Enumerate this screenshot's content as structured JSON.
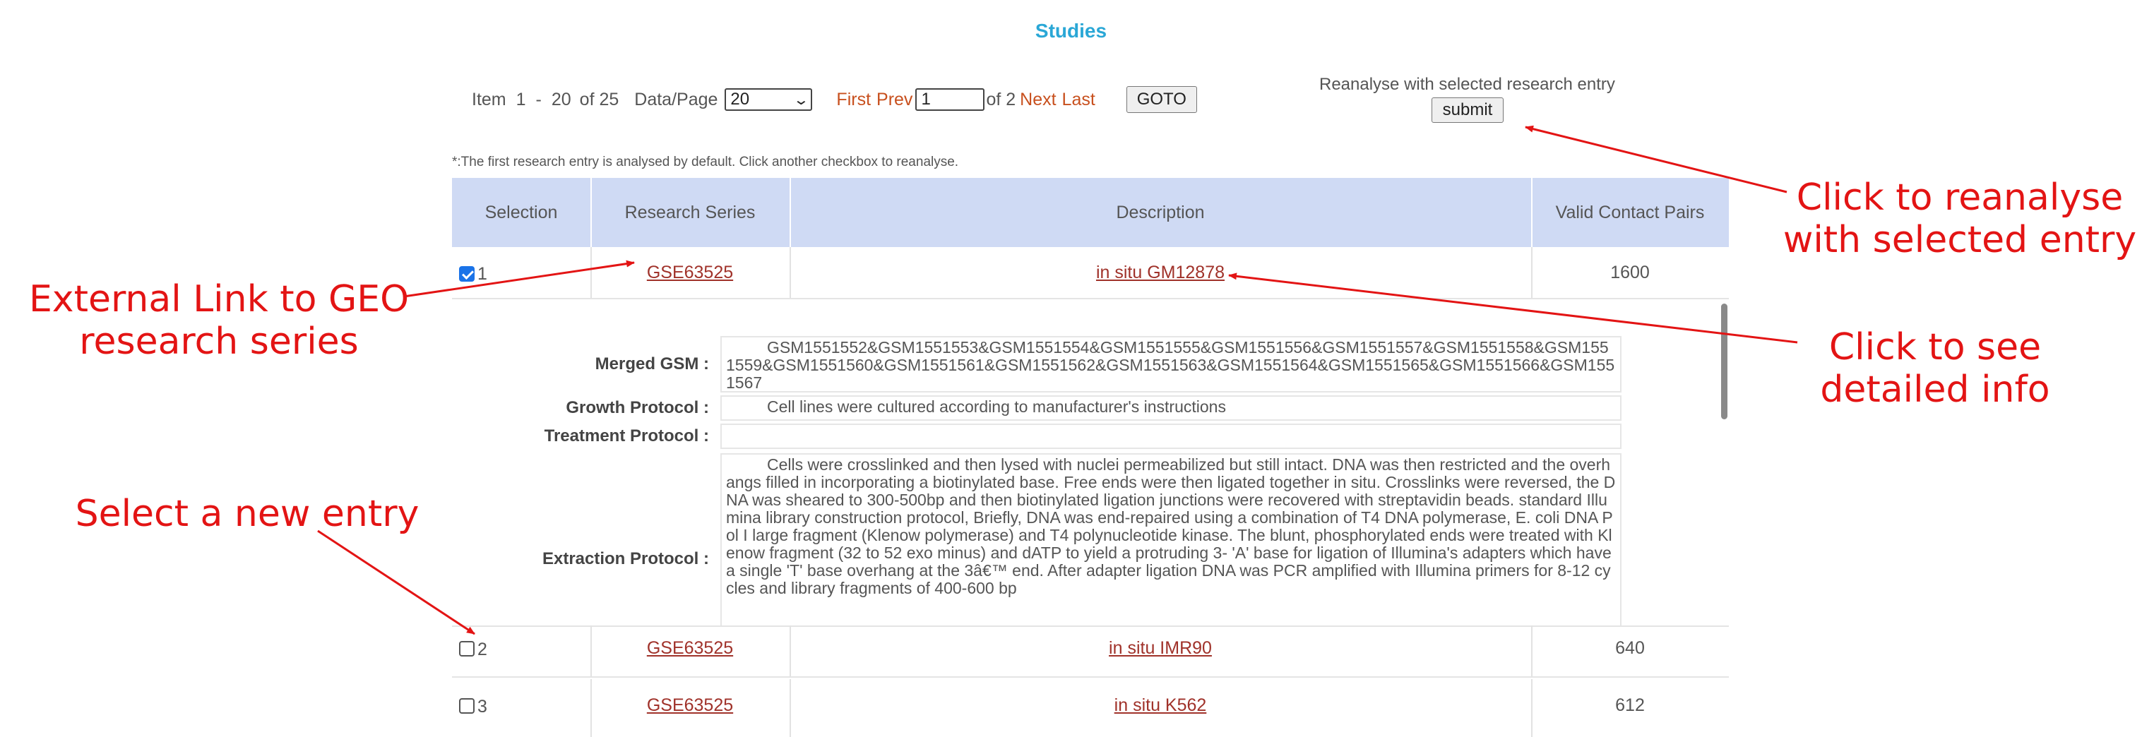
{
  "page": {
    "title": "Studies"
  },
  "pager": {
    "item_label": "Item",
    "item_start": "1",
    "item_dash": "-",
    "item_end": "20",
    "of_total": "of 25",
    "data_page_label": "Data/Page",
    "page_size": "20",
    "first": "First",
    "prev": "Prev",
    "current_page": "1",
    "of_pages": "of 2",
    "next": "Next",
    "last": "Last",
    "goto": "GOTO"
  },
  "reanalyse": {
    "label": "Reanalyse with selected research entry",
    "submit": "submit"
  },
  "note": "*:The first research entry is analysed by default. Click another checkbox to reanalyse.",
  "table": {
    "headers": [
      "Selection",
      "Research Series",
      "Description",
      "Valid Contact Pairs"
    ],
    "rows": [
      {
        "index": "1",
        "checked": true,
        "series": "GSE63525",
        "description": "in situ GM12878",
        "pairs": "1600"
      },
      {
        "index": "2",
        "checked": false,
        "series": "GSE63525",
        "description": "in situ IMR90",
        "pairs": "640"
      },
      {
        "index": "3",
        "checked": false,
        "series": "GSE63525",
        "description": "in situ K562",
        "pairs": "612"
      }
    ]
  },
  "detail": {
    "merged_gsm_label": "Merged GSM :",
    "merged_gsm": "GSM1551552&GSM1551553&GSM1551554&GSM1551555&GSM1551556&GSM1551557&GSM1551558&GSM1551559&GSM1551560&GSM1551561&GSM1551562&GSM1551563&GSM1551564&GSM1551565&GSM1551566&GSM1551567",
    "growth_label": "Growth Protocol :",
    "growth": "Cell lines were cultured according to manufacturer's instructions",
    "treatment_label": "Treatment Protocol :",
    "treatment": "",
    "extraction_label": "Extraction Protocol :",
    "extraction": "Cells were crosslinked and then lysed with nuclei permeabilized but still intact. DNA was then restricted and the overhangs filled in incorporating a biotinylated base. Free ends were then ligated together in situ. Crosslinks were reversed, the DNA was sheared to 300-500bp and then biotinylated ligation junctions were recovered with streptavidin beads. standard Illumina library construction protocol, Briefly, DNA was end-repaired using a combination of T4 DNA polymerase, E. coli DNA Pol I large fragment (Klenow polymerase) and T4 polynucleotide kinase. The blunt, phosphorylated ends were treated with Klenow fragment (32 to 52 exo minus) and dATP to yield a protruding 3- 'A' base for ligation of Illumina's adapters which have a single 'T' base overhang at the 3â€™ end. After adapter ligation DNA was PCR amplified with Illumina primers for 8-12 cycles and library fragments of 400-600 bp"
  },
  "annotations": {
    "external_link_line1": "External Link to GEO",
    "external_link_line2": "research series",
    "reanalyse_line1": "Click to reanalyse",
    "reanalyse_line2": "with selected entry",
    "detail_line1": "Click to see",
    "detail_line2": "detailed info",
    "select_new": "Select a new entry"
  },
  "colors": {
    "title": "#2aa7d6",
    "header_bg": "#cfdaf4",
    "link": "#a0322a",
    "pager_link": "#c8501e",
    "annotation": "#e31414",
    "checkbox_checked": "#1a73e8"
  }
}
